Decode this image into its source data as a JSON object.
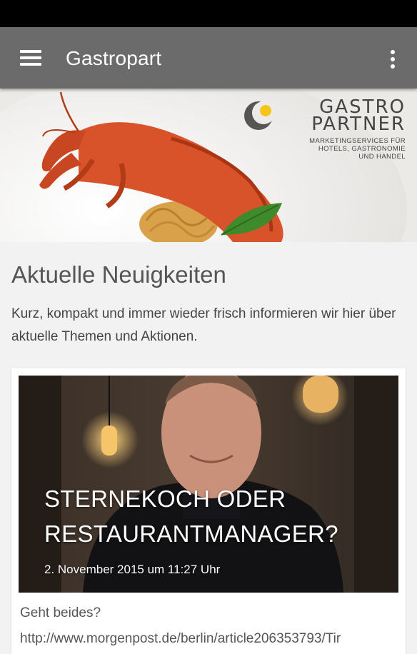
{
  "app_bar": {
    "title": "Gastropart",
    "menu_icon": "hamburger-menu-icon",
    "overflow_icon": "more-vert-icon",
    "color": "#6b6b6b"
  },
  "banner": {
    "logo_line1": "GASTRO",
    "logo_line2": "PARTNER",
    "logo_tagline_1": "MARKETINGSERVICES FÜR",
    "logo_tagline_2": "HOTELS, GASTRONOMIE",
    "logo_tagline_3": "UND HANDEL",
    "logo_accent": "#f5c518"
  },
  "news": {
    "heading": "Aktuelle Neuigkeiten",
    "intro": "Kurz, kompakt und immer wieder frisch informieren wir hier über aktuelle Themen und Aktionen."
  },
  "article": {
    "headline": "STERNEKOCH ODER RESTAURANTMANAGER?",
    "date": "2. November 2015 um 11:27 Uhr",
    "excerpt": "Geht beides?",
    "link": "http://www.morgenpost.de/berlin/article206353793/Tir"
  }
}
